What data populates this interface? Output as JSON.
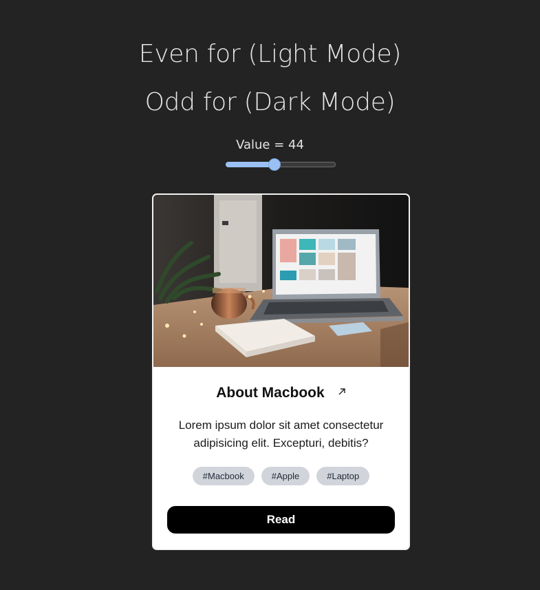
{
  "headings": {
    "line1": "Even for (Light Mode)",
    "line2": "Odd for (Dark Mode)"
  },
  "slider": {
    "label": "Value = 44",
    "value": 44,
    "min": 0,
    "max": 100,
    "accent_color": "#9ac0f4"
  },
  "card": {
    "image_icon": "laptop-photo",
    "title": "About Macbook",
    "title_icon": "arrow-up-right-icon",
    "description": "Lorem ipsum dolor sit amet consectetur adipisicing elit. Excepturi, debitis?",
    "tags": [
      "#Macbook",
      "#Apple",
      "#Laptop"
    ],
    "button_label": "Read"
  },
  "colors": {
    "background": "#232323",
    "card_background": "#ffffff",
    "button_background": "#000000",
    "tag_background": "#d1d5db"
  }
}
